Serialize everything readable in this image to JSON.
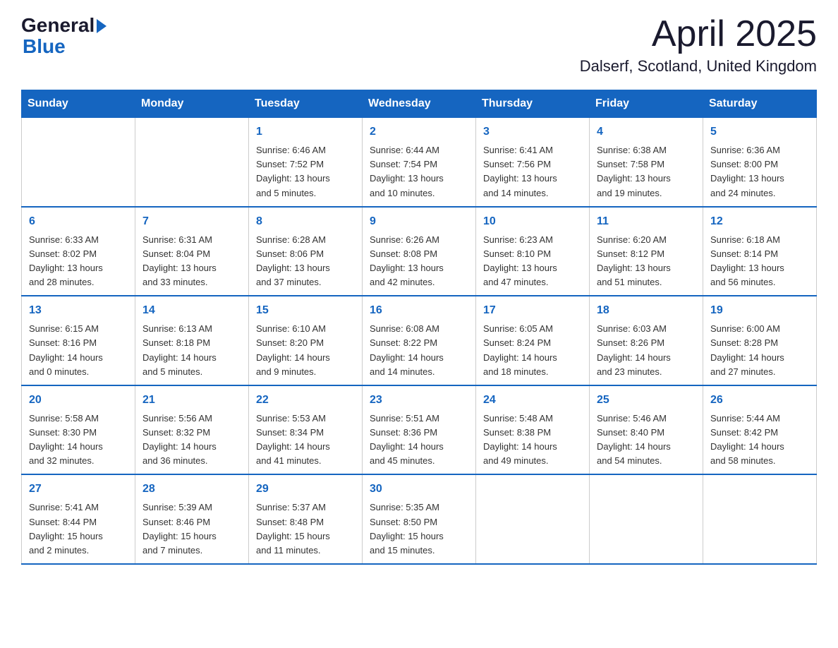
{
  "header": {
    "logo_general": "General",
    "logo_blue": "Blue",
    "month": "April 2025",
    "location": "Dalserf, Scotland, United Kingdom"
  },
  "weekdays": [
    "Sunday",
    "Monday",
    "Tuesday",
    "Wednesday",
    "Thursday",
    "Friday",
    "Saturday"
  ],
  "weeks": [
    [
      {
        "day": "",
        "info": ""
      },
      {
        "day": "",
        "info": ""
      },
      {
        "day": "1",
        "info": "Sunrise: 6:46 AM\nSunset: 7:52 PM\nDaylight: 13 hours\nand 5 minutes."
      },
      {
        "day": "2",
        "info": "Sunrise: 6:44 AM\nSunset: 7:54 PM\nDaylight: 13 hours\nand 10 minutes."
      },
      {
        "day": "3",
        "info": "Sunrise: 6:41 AM\nSunset: 7:56 PM\nDaylight: 13 hours\nand 14 minutes."
      },
      {
        "day": "4",
        "info": "Sunrise: 6:38 AM\nSunset: 7:58 PM\nDaylight: 13 hours\nand 19 minutes."
      },
      {
        "day": "5",
        "info": "Sunrise: 6:36 AM\nSunset: 8:00 PM\nDaylight: 13 hours\nand 24 minutes."
      }
    ],
    [
      {
        "day": "6",
        "info": "Sunrise: 6:33 AM\nSunset: 8:02 PM\nDaylight: 13 hours\nand 28 minutes."
      },
      {
        "day": "7",
        "info": "Sunrise: 6:31 AM\nSunset: 8:04 PM\nDaylight: 13 hours\nand 33 minutes."
      },
      {
        "day": "8",
        "info": "Sunrise: 6:28 AM\nSunset: 8:06 PM\nDaylight: 13 hours\nand 37 minutes."
      },
      {
        "day": "9",
        "info": "Sunrise: 6:26 AM\nSunset: 8:08 PM\nDaylight: 13 hours\nand 42 minutes."
      },
      {
        "day": "10",
        "info": "Sunrise: 6:23 AM\nSunset: 8:10 PM\nDaylight: 13 hours\nand 47 minutes."
      },
      {
        "day": "11",
        "info": "Sunrise: 6:20 AM\nSunset: 8:12 PM\nDaylight: 13 hours\nand 51 minutes."
      },
      {
        "day": "12",
        "info": "Sunrise: 6:18 AM\nSunset: 8:14 PM\nDaylight: 13 hours\nand 56 minutes."
      }
    ],
    [
      {
        "day": "13",
        "info": "Sunrise: 6:15 AM\nSunset: 8:16 PM\nDaylight: 14 hours\nand 0 minutes."
      },
      {
        "day": "14",
        "info": "Sunrise: 6:13 AM\nSunset: 8:18 PM\nDaylight: 14 hours\nand 5 minutes."
      },
      {
        "day": "15",
        "info": "Sunrise: 6:10 AM\nSunset: 8:20 PM\nDaylight: 14 hours\nand 9 minutes."
      },
      {
        "day": "16",
        "info": "Sunrise: 6:08 AM\nSunset: 8:22 PM\nDaylight: 14 hours\nand 14 minutes."
      },
      {
        "day": "17",
        "info": "Sunrise: 6:05 AM\nSunset: 8:24 PM\nDaylight: 14 hours\nand 18 minutes."
      },
      {
        "day": "18",
        "info": "Sunrise: 6:03 AM\nSunset: 8:26 PM\nDaylight: 14 hours\nand 23 minutes."
      },
      {
        "day": "19",
        "info": "Sunrise: 6:00 AM\nSunset: 8:28 PM\nDaylight: 14 hours\nand 27 minutes."
      }
    ],
    [
      {
        "day": "20",
        "info": "Sunrise: 5:58 AM\nSunset: 8:30 PM\nDaylight: 14 hours\nand 32 minutes."
      },
      {
        "day": "21",
        "info": "Sunrise: 5:56 AM\nSunset: 8:32 PM\nDaylight: 14 hours\nand 36 minutes."
      },
      {
        "day": "22",
        "info": "Sunrise: 5:53 AM\nSunset: 8:34 PM\nDaylight: 14 hours\nand 41 minutes."
      },
      {
        "day": "23",
        "info": "Sunrise: 5:51 AM\nSunset: 8:36 PM\nDaylight: 14 hours\nand 45 minutes."
      },
      {
        "day": "24",
        "info": "Sunrise: 5:48 AM\nSunset: 8:38 PM\nDaylight: 14 hours\nand 49 minutes."
      },
      {
        "day": "25",
        "info": "Sunrise: 5:46 AM\nSunset: 8:40 PM\nDaylight: 14 hours\nand 54 minutes."
      },
      {
        "day": "26",
        "info": "Sunrise: 5:44 AM\nSunset: 8:42 PM\nDaylight: 14 hours\nand 58 minutes."
      }
    ],
    [
      {
        "day": "27",
        "info": "Sunrise: 5:41 AM\nSunset: 8:44 PM\nDaylight: 15 hours\nand 2 minutes."
      },
      {
        "day": "28",
        "info": "Sunrise: 5:39 AM\nSunset: 8:46 PM\nDaylight: 15 hours\nand 7 minutes."
      },
      {
        "day": "29",
        "info": "Sunrise: 5:37 AM\nSunset: 8:48 PM\nDaylight: 15 hours\nand 11 minutes."
      },
      {
        "day": "30",
        "info": "Sunrise: 5:35 AM\nSunset: 8:50 PM\nDaylight: 15 hours\nand 15 minutes."
      },
      {
        "day": "",
        "info": ""
      },
      {
        "day": "",
        "info": ""
      },
      {
        "day": "",
        "info": ""
      }
    ]
  ]
}
